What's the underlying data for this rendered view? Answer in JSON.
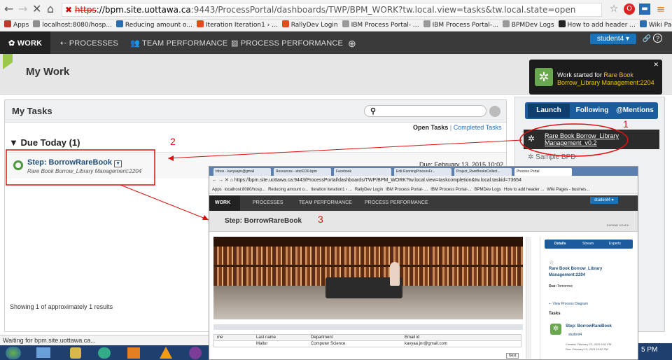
{
  "browser": {
    "url_prefix": "https",
    "url_host": "://bpm.site.uottawa.ca",
    "url_rest": ":9443/ProcessPortal/dashboards/TWP/BPM_WORK?tw.local.view=tasks&tw.local.state=open",
    "bookmarks": [
      {
        "label": "Apps",
        "color": "#c0392b"
      },
      {
        "label": "localhost:8080/hosp...",
        "color": "#8e8e8e"
      },
      {
        "label": "Reducing amount o...",
        "color": "#2a6db0"
      },
      {
        "label": "Iteration Iteration1 › ...",
        "color": "#e04e1b"
      },
      {
        "label": "RallyDev Login",
        "color": "#e04e1b"
      },
      {
        "label": "IBM Process Portal- ...",
        "color": "#999999"
      },
      {
        "label": "IBM Process Portal-...",
        "color": "#999999"
      },
      {
        "label": "BPMDev Logs",
        "color": "#999999"
      },
      {
        "label": "How to add header ...",
        "color": "#222222"
      },
      {
        "label": "Wiki Pages - busines...",
        "color": "#2a6db0"
      }
    ]
  },
  "nav": {
    "items": [
      "WORK",
      "PROCESSES",
      "TEAM PERFORMANCE",
      "PROCESS PERFORMANCE"
    ],
    "user": "student4 ▾"
  },
  "header": {
    "title": "My Work",
    "notify_prefix": "Work started for ",
    "notify_link": "Rare Book Borrow_Library Management:2204"
  },
  "tasks": {
    "title": "My Tasks",
    "open_label": "Open Tasks",
    "separator": "|",
    "completed_label": "Completed Tasks",
    "due_heading": "Due Today (1)",
    "item_title": "Step: BorrowRareBook",
    "item_sub": "Rare Book Borrow_Library Management:2204",
    "item_due": "Due: February 13, 2015 10:02 PM",
    "results": "Showing 1 of approximately 1 results"
  },
  "side": {
    "tabs": [
      "Launch",
      "Following",
      "@Mentions"
    ],
    "launch_item": "Rare Book Borrow_Library Management_v0.2",
    "sample": "Sample BPD"
  },
  "annotations": [
    "1",
    "2",
    "3"
  ],
  "status": "Waiting for bpm.site.uottawa.ca...",
  "overlay": {
    "tabs": [
      "Inbox - kavyaajnr@gmail",
      "Resources - ebc6230-bpm",
      "Facebook",
      "Edit RunningProcessFr...",
      "Project_RareBooksCollect...",
      "Process Portal"
    ],
    "url": "https://bpm.site.uottawa.ca:9443/ProcessPortal/dashboards/TWP/BPM_WORK?tw.local.view=taskcompletion&tw.local.taskid=73654",
    "nav": [
      "WORK",
      "PROCESSES",
      "TEAM PERFORMANCE",
      "PROCESS PERFORMANCE"
    ],
    "user": "student4 ▾",
    "title": "Step: BorrowRareBook",
    "expand": "EXPAND COACH",
    "table_headers": [
      "me",
      "Last name",
      "Department",
      "Email id"
    ],
    "table_row": [
      "",
      "Mallur",
      "Computer Science",
      "kavyaa.jnr@gmail.com"
    ],
    "next": "Next",
    "side_tabs": [
      "Details",
      "Stream",
      "Experts"
    ],
    "side_title": "Rare Book Borrow_Library Management:2204",
    "side_due_label": "Due:",
    "side_due": "Tomorrow",
    "view_diagram": "View Process Diagram",
    "tasks_label": "Tasks",
    "task_name": "Step: BorrowRareBook",
    "task_user": "student4",
    "created": "Created: February 13, 2015 9:02 PM",
    "due": "Due: February 13, 2015 10:02 PM"
  },
  "clock": "5 PM"
}
